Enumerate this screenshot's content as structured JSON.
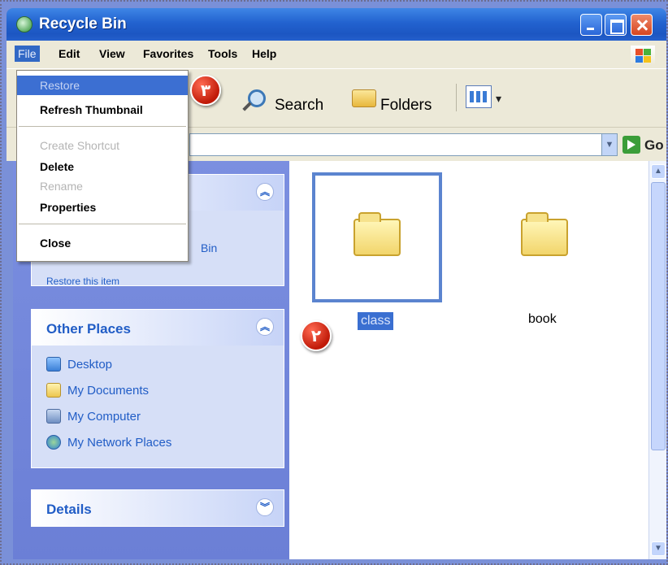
{
  "window": {
    "title": "Recycle Bin"
  },
  "menu": [
    "File",
    "Edit",
    "View",
    "Favorites",
    "Tools",
    "Help"
  ],
  "toolbar": {
    "search": "Search",
    "folders": "Folders"
  },
  "address": {
    "go": "Go",
    "value": ""
  },
  "file_menu": {
    "items": [
      {
        "label": "Restore",
        "state": "highlighted"
      },
      {
        "label": "Refresh Thumbnail",
        "state": "enabled"
      },
      {
        "label": "Create Shortcut",
        "state": "disabled"
      },
      {
        "label": "Delete",
        "state": "enabled"
      },
      {
        "label": "Rename",
        "state": "disabled"
      },
      {
        "label": "Properties",
        "state": "enabled"
      },
      {
        "label": "Close",
        "state": "enabled"
      }
    ]
  },
  "tasks": {
    "partial_text": "Bin",
    "restore_text": "Restore this item"
  },
  "other_places": {
    "title": "Other Places",
    "items": [
      "Desktop",
      "My Documents",
      "My Computer",
      "My Network Places"
    ]
  },
  "details": {
    "title": "Details"
  },
  "files": [
    {
      "name": "class",
      "selected": true
    },
    {
      "name": "book",
      "selected": false
    }
  ],
  "badges": {
    "restore_step": "٣",
    "select_step": "٢"
  },
  "colors": {
    "badge": "#c01a08",
    "selection": "#3a6fd1",
    "taskpane": "#7b8fe0",
    "link": "#215dc6"
  }
}
